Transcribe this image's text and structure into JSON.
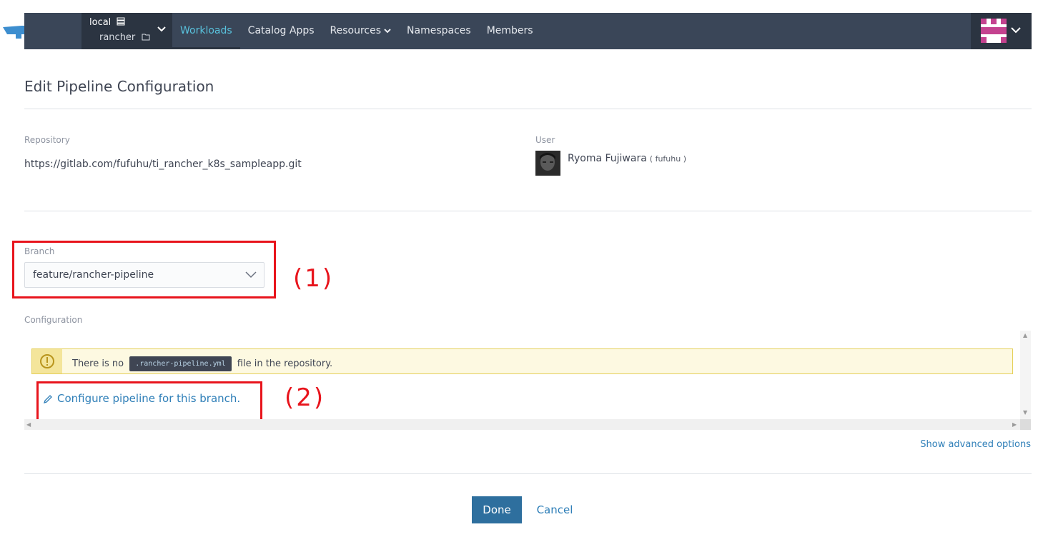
{
  "header": {
    "cluster": "local",
    "project": "rancher",
    "nav": [
      {
        "label": "Workloads",
        "active": true
      },
      {
        "label": "Catalog Apps"
      },
      {
        "label": "Resources"
      },
      {
        "label": "Namespaces"
      },
      {
        "label": "Members"
      }
    ],
    "brand_color": "#3a4658",
    "active_color": "#59c2dd"
  },
  "page": {
    "title": "Edit Pipeline Configuration",
    "repository_label": "Repository",
    "repository_url": "https://gitlab.com/fufuhu/ti_rancher_k8s_sampleapp.git",
    "user_label": "User",
    "user_name": "Ryoma Fujiwara",
    "user_handle": "( fufuhu )",
    "branch_label": "Branch",
    "branch_value": "feature/rancher-pipeline",
    "configuration_label": "Configuration",
    "warning_prefix": "There is no",
    "warning_file": ".rancher-pipeline.yml",
    "warning_suffix": "file in the repository.",
    "configure_link": "Configure pipeline for this branch.",
    "advanced_link": "Show advanced options",
    "done_label": "Done",
    "cancel_label": "Cancel"
  },
  "annotations": {
    "one": "(1)",
    "two": "(2)"
  }
}
